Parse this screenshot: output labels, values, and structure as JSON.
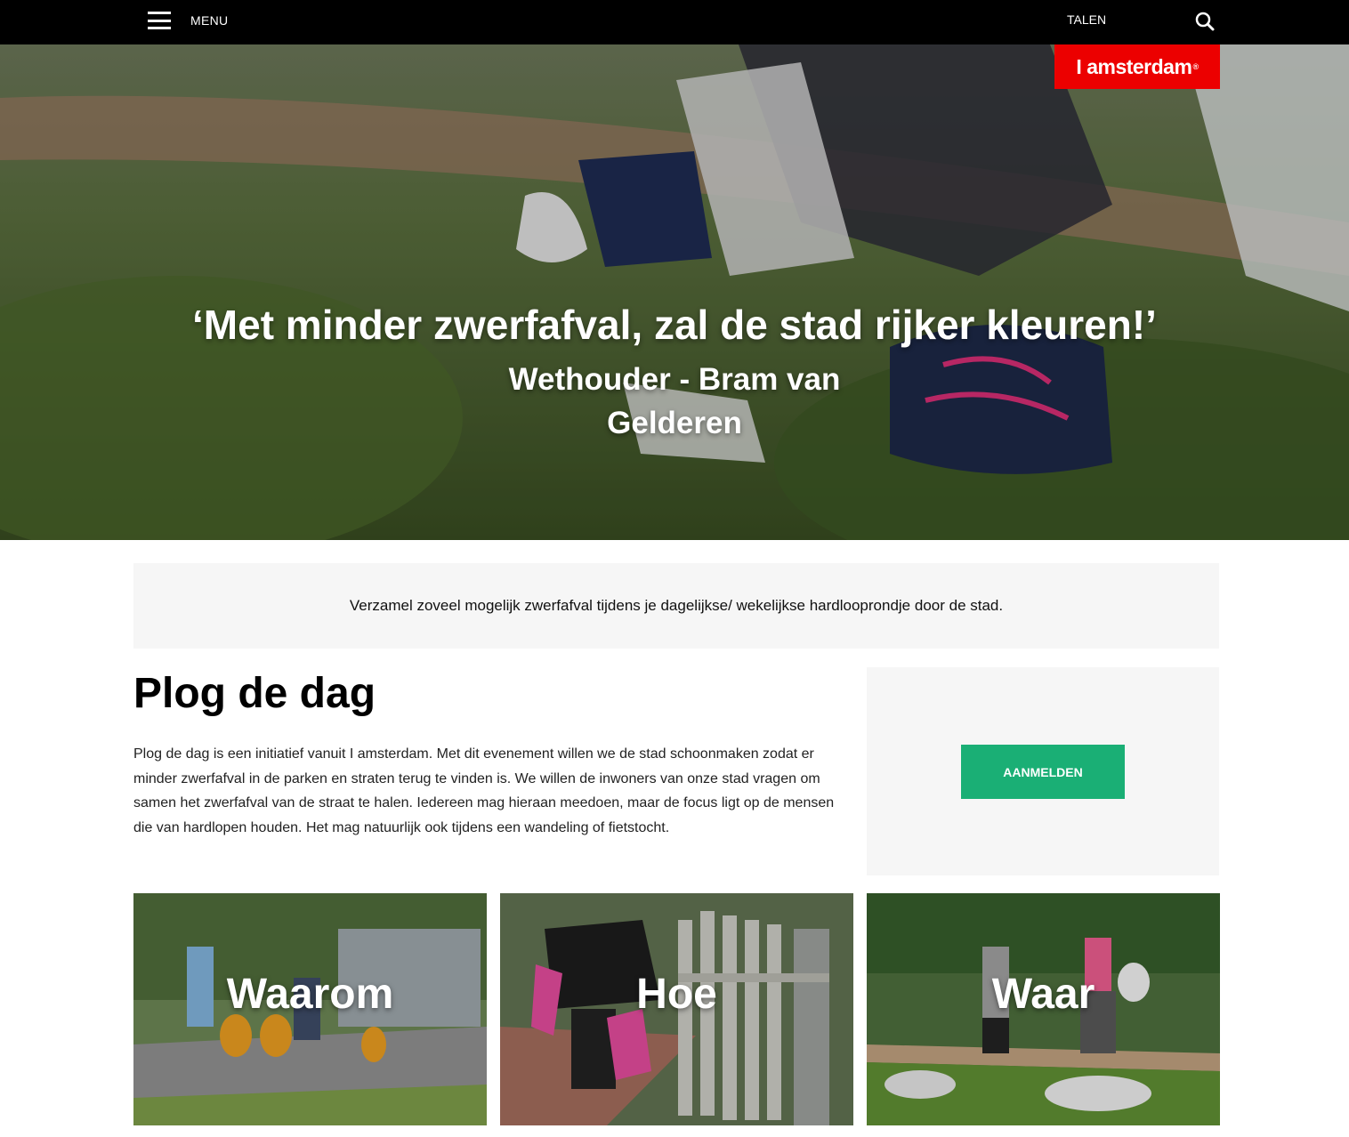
{
  "header": {
    "menu_label": "MENU",
    "languages_label": "TALEN",
    "logo_text": "I amsterdam",
    "logo_mark": "®",
    "icons": {
      "menu": "hamburger-icon",
      "search": "search-icon"
    }
  },
  "hero": {
    "quote": "‘Met minder zwerfafval, zal de stad rijker kleuren!’",
    "author_line1": "Wethouder - Bram van",
    "author_line2": "Gelderen"
  },
  "intro": {
    "text": "Verzamel zoveel mogelijk zwerfafval tijdens je dagelijkse/ wekelijkse hardlooprondje door de stad."
  },
  "main": {
    "title": "Plog de dag",
    "body": "Plog de dag is een initiatief vanuit I amsterdam. Met dit evenement willen we de stad schoonmaken zodat er minder zwerfafval in de parken en straten terug te vinden is. We willen de inwoners van onze stad vragen om samen het zwerfafval van de straat te halen. Iedereen mag hieraan meedoen, maar de focus ligt op de mensen die van hardlopen houden. Het mag natuurlijk ook tijdens een wandeling of fietstocht."
  },
  "signup": {
    "button_label": "AANMELDEN"
  },
  "cards": [
    {
      "label": "Waarom"
    },
    {
      "label": "Hoe"
    },
    {
      "label": "Waar"
    }
  ],
  "colors": {
    "topbar": "#000000",
    "logo_red": "#ec0000",
    "button_green": "#1aaf75",
    "panel_gray": "#f6f6f6"
  }
}
